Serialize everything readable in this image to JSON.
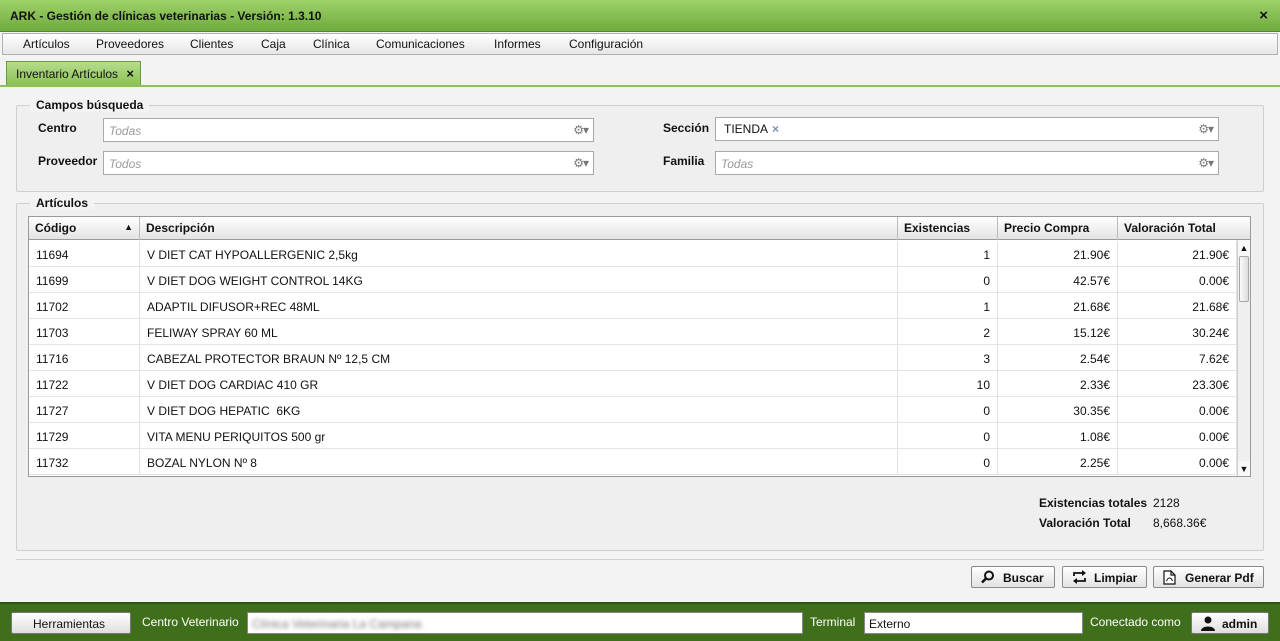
{
  "window": {
    "title": "ARK - Gestión de clínicas veterinarias - Versión: 1.3.10",
    "close": "×"
  },
  "menu": [
    "Artículos",
    "Proveedores",
    "Clientes",
    "Caja",
    "Clínica",
    "Comunicaciones",
    "Informes",
    "Configuración"
  ],
  "tab": {
    "label": "Inventario Artículos",
    "close": "×"
  },
  "search": {
    "legend": "Campos búsqueda",
    "centro": {
      "label": "Centro",
      "placeholder": "Todas"
    },
    "proveedor": {
      "label": "Proveedor",
      "placeholder": "Todos"
    },
    "seccion": {
      "label": "Sección",
      "value": "TIENDA",
      "remove": "×"
    },
    "familia": {
      "label": "Familia",
      "placeholder": "Todas"
    }
  },
  "articles": {
    "legend": "Artículos",
    "columns": [
      "Código",
      "Descripción",
      "Existencias",
      "Precio Compra",
      "Valoración Total"
    ],
    "sort_indicator": "▲",
    "rows": [
      [
        "11694",
        "V DIET CAT HYPOALLERGENIC 2,5kg",
        "1",
        "21.90€",
        "21.90€"
      ],
      [
        "11699",
        "V DIET DOG WEIGHT CONTROL 14KG",
        "0",
        "42.57€",
        "0.00€"
      ],
      [
        "11702",
        "ADAPTIL DIFUSOR+REC 48ML",
        "1",
        "21.68€",
        "21.68€"
      ],
      [
        "11703",
        "FELIWAY SPRAY 60 ML",
        "2",
        "15.12€",
        "30.24€"
      ],
      [
        "11716",
        "CABEZAL PROTECTOR BRAUN Nº 12,5 CM",
        "3",
        "2.54€",
        "7.62€"
      ],
      [
        "11722",
        "V DIET DOG CARDIAC 410 GR",
        "10",
        "2.33€",
        "23.30€"
      ],
      [
        "11727",
        "V DIET DOG HEPATIC  6KG",
        "0",
        "30.35€",
        "0.00€"
      ],
      [
        "11729",
        "VITA MENU PERIQUITOS 500 gr",
        "0",
        "1.08€",
        "0.00€"
      ],
      [
        "11732",
        "BOZAL NYLON Nº 8",
        "0",
        "2.25€",
        "0.00€"
      ]
    ]
  },
  "totals": {
    "existencias_label": "Existencias totales",
    "existencias_value": "2128",
    "valoracion_label": "Valoración Total",
    "valoracion_value": "8,668.36€"
  },
  "buttons": {
    "buscar": "Buscar",
    "limpiar": "Limpiar",
    "pdf": "Generar Pdf"
  },
  "status": {
    "herramientas": "Herramientas",
    "centro_label": "Centro Veterinario",
    "centro_value": "Clínica Veterinaria La Campana",
    "terminal_label": "Terminal",
    "terminal_value": "Externo",
    "conectado_label": "Conectado como",
    "user": "admin"
  },
  "colors": {
    "title_green": "#7fbd47",
    "status_green": "#3f6f1a"
  }
}
